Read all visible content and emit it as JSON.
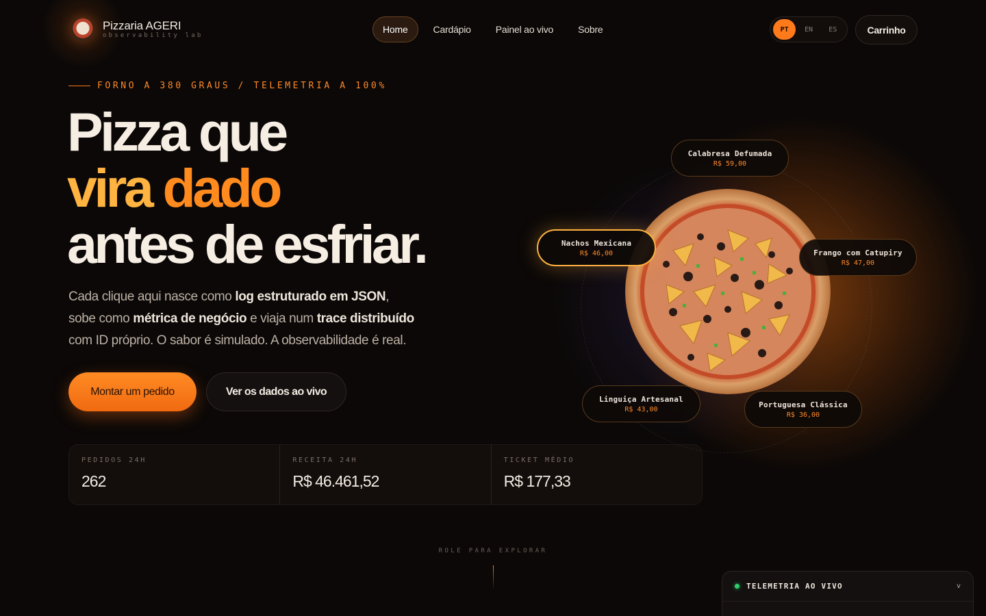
{
  "brand": {
    "name": "Pizzaria AGERI",
    "tagline": "observability lab"
  },
  "nav": {
    "items": [
      {
        "label": "Home",
        "active": true
      },
      {
        "label": "Cardápio",
        "active": false
      },
      {
        "label": "Painel ao vivo",
        "active": false
      },
      {
        "label": "Sobre",
        "active": false
      }
    ]
  },
  "languages": {
    "options": [
      "PT",
      "EN",
      "ES"
    ],
    "selected": "PT"
  },
  "cart": {
    "label": "Carrinho"
  },
  "hero": {
    "eyebrow": "FORNO A 380 GRAUS / TELEMETRIA A 100%",
    "headline": {
      "line1": "Pizza que",
      "line2_a": "vira",
      "line2_b": "dado",
      "line3": "antes de esfriar."
    },
    "lede": {
      "p1": "Cada clique aqui nasce como ",
      "b1": "log estruturado em JSON",
      "p2": ",",
      "p3": "sobe como ",
      "b2": "métrica de negócio",
      "p4": " e viaja num ",
      "b3": "trace distribuído",
      "p5": "com ID próprio. O sabor é simulado. A observabilidade é real."
    },
    "primary_cta": "Montar um pedido",
    "secondary_cta": "Ver os dados ao vivo"
  },
  "stats": [
    {
      "label": "PEDIDOS 24H",
      "value": "262"
    },
    {
      "label": "RECEITA 24H",
      "value": "R$ 46.461,52"
    },
    {
      "label": "TICKET MÉDIO",
      "value": "R$ 177,33"
    }
  ],
  "pizza_menu": {
    "items": [
      {
        "name": "Calabresa Defumada",
        "price": "R$ 59,00",
        "active": false
      },
      {
        "name": "Nachos Mexicana",
        "price": "R$ 46,00",
        "active": true
      },
      {
        "name": "Frango com Catupiry",
        "price": "R$ 47,00",
        "active": false
      },
      {
        "name": "Linguiça Artesanal",
        "price": "R$ 43,00",
        "active": false
      },
      {
        "name": "Portuguesa Clássica",
        "price": "R$ 36,00",
        "active": false
      }
    ]
  },
  "scroll_hint": "ROLE PARA EXPLORAR",
  "telemetry": {
    "title": "TELEMETRIA AO VIVO",
    "toggle": "v",
    "status_color": "#2ecf6a"
  },
  "colors": {
    "accent": "#ff7a1a",
    "accent_light": "#ffb340",
    "background": "#0b0807"
  }
}
